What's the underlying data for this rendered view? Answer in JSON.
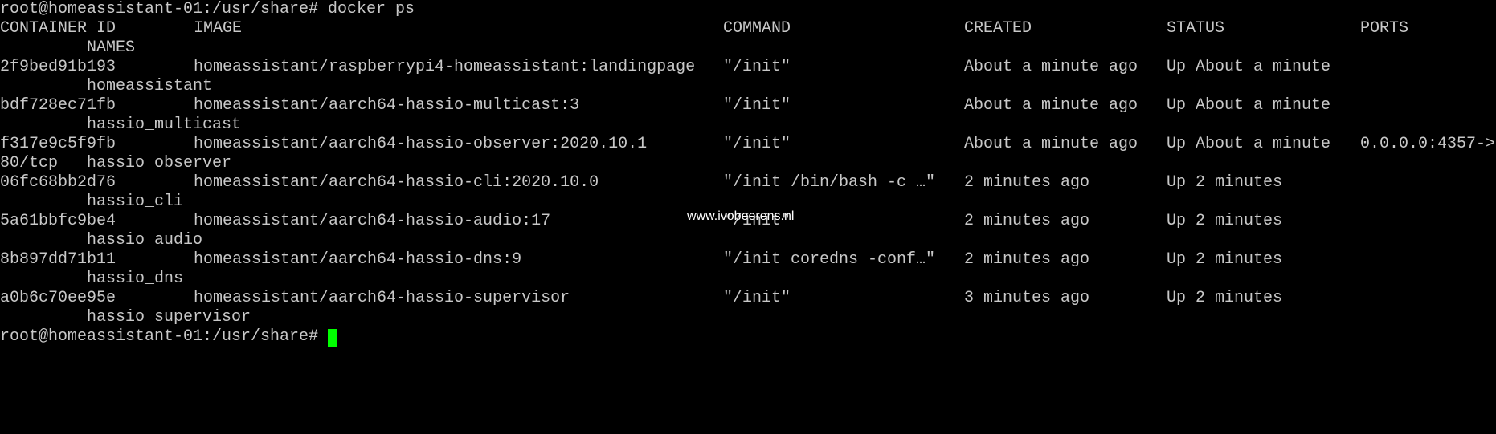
{
  "terminal": {
    "prompt": "root@homeassistant-01:/usr/share#",
    "command": "docker ps",
    "headers": {
      "container_id": "CONTAINER ID",
      "image": "IMAGE",
      "command": "COMMAND",
      "created": "CREATED",
      "status": "STATUS",
      "ports": "PORTS",
      "names": "NAMES"
    },
    "rows": [
      {
        "id": "2f9bed91b193",
        "image": "homeassistant/raspberrypi4-homeassistant:landingpage",
        "command": "\"/init\"",
        "created": "About a minute ago",
        "status": "Up About a minute",
        "ports": "",
        "ports_cont": "",
        "names": "homeassistant"
      },
      {
        "id": "bdf728ec71fb",
        "image": "homeassistant/aarch64-hassio-multicast:3",
        "command": "\"/init\"",
        "created": "About a minute ago",
        "status": "Up About a minute",
        "ports": "",
        "ports_cont": "",
        "names": "hassio_multicast"
      },
      {
        "id": "f317e9c5f9fb",
        "image": "homeassistant/aarch64-hassio-observer:2020.10.1",
        "command": "\"/init\"",
        "created": "About a minute ago",
        "status": "Up About a minute",
        "ports": "0.0.0.0:4357->",
        "ports_cont": "80/tcp",
        "names": "hassio_observer"
      },
      {
        "id": "06fc68bb2d76",
        "image": "homeassistant/aarch64-hassio-cli:2020.10.0",
        "command": "\"/init /bin/bash -c …\"",
        "created": "2 minutes ago",
        "status": "Up 2 minutes",
        "ports": "",
        "ports_cont": "",
        "names": "hassio_cli"
      },
      {
        "id": "5a61bbfc9be4",
        "image": "homeassistant/aarch64-hassio-audio:17",
        "command": "\"/init\"",
        "created": "2 minutes ago",
        "status": "Up 2 minutes",
        "ports": "",
        "ports_cont": "",
        "names": "hassio_audio"
      },
      {
        "id": "8b897dd71b11",
        "image": "homeassistant/aarch64-hassio-dns:9",
        "command": "\"/init coredns -conf…\"",
        "created": "2 minutes ago",
        "status": "Up 2 minutes",
        "ports": "",
        "ports_cont": "",
        "names": "hassio_dns"
      },
      {
        "id": "a0b6c70ee95e",
        "image": "homeassistant/aarch64-hassio-supervisor",
        "command": "\"/init\"",
        "created": "3 minutes ago",
        "status": "Up 2 minutes",
        "ports": "",
        "ports_cont": "",
        "names": "hassio_supervisor"
      }
    ]
  },
  "watermark": "www.ivobeerens.nl",
  "colors": {
    "background": "#000000",
    "text": "#c8c8c8",
    "cursor": "#00ff00"
  }
}
